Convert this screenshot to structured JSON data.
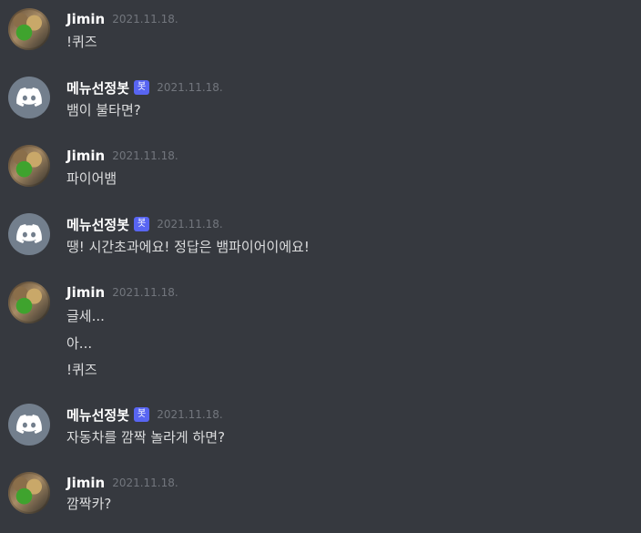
{
  "messages": [
    {
      "author": "Jimin",
      "timestamp": "2021.11.18.",
      "is_bot": false,
      "lines": [
        "!퀴즈"
      ]
    },
    {
      "author": "메뉴선정봇",
      "badge": "봇",
      "timestamp": "2021.11.18.",
      "is_bot": true,
      "lines": [
        "뱀이 불타면?"
      ]
    },
    {
      "author": "Jimin",
      "timestamp": "2021.11.18.",
      "is_bot": false,
      "lines": [
        "파이어뱀"
      ]
    },
    {
      "author": "메뉴선정봇",
      "badge": "봇",
      "timestamp": "2021.11.18.",
      "is_bot": true,
      "lines": [
        "땡! 시간초과에요! 정답은 뱀파이어이에요!"
      ]
    },
    {
      "author": "Jimin",
      "timestamp": "2021.11.18.",
      "is_bot": false,
      "lines": [
        "글세...",
        "아...",
        "!퀴즈"
      ]
    },
    {
      "author": "메뉴선정봇",
      "badge": "봇",
      "timestamp": "2021.11.18.",
      "is_bot": true,
      "lines": [
        "자동차를 깜짝 놀라게 하면?"
      ]
    },
    {
      "author": "Jimin",
      "timestamp": "2021.11.18.",
      "is_bot": false,
      "lines": [
        "깜짝카?"
      ]
    }
  ],
  "colors": {
    "background": "#36393f",
    "author": "#ffffff",
    "timestamp": "#72767d",
    "message_text": "#dcddde",
    "bot_badge": "#5865f2",
    "bot_avatar": "#737f8d"
  },
  "icons": {
    "bot_avatar": "discord-logo-icon",
    "user_avatar": "user-photo-avatar"
  }
}
